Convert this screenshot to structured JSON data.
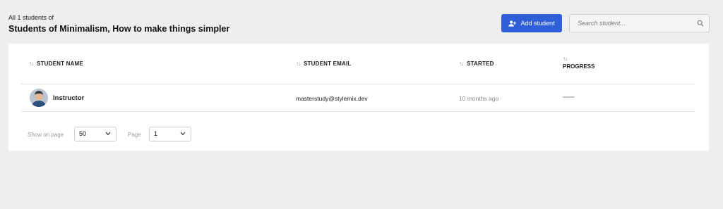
{
  "header": {
    "subtitle": "All 1 students of",
    "title": "Students of Minimalism, How to make things simpler",
    "add_button_label": "Add student",
    "search_placeholder": "Search student..."
  },
  "table": {
    "columns": [
      {
        "label": "STUDENT NAME"
      },
      {
        "label": "STUDENT EMAIL"
      },
      {
        "label": "STARTED"
      },
      {
        "label": "PROGRESS"
      }
    ],
    "rows": [
      {
        "name": "Instructor",
        "email": "masterstudy@stylemix.dev",
        "started": "10 months ago",
        "progress": "—"
      }
    ]
  },
  "pagination": {
    "show_on_page_label": "Show on page",
    "show_on_page_value": "50",
    "page_label": "Page",
    "page_value": "1"
  },
  "colors": {
    "accent": "#2f5fd6",
    "background": "#eeeeee"
  }
}
